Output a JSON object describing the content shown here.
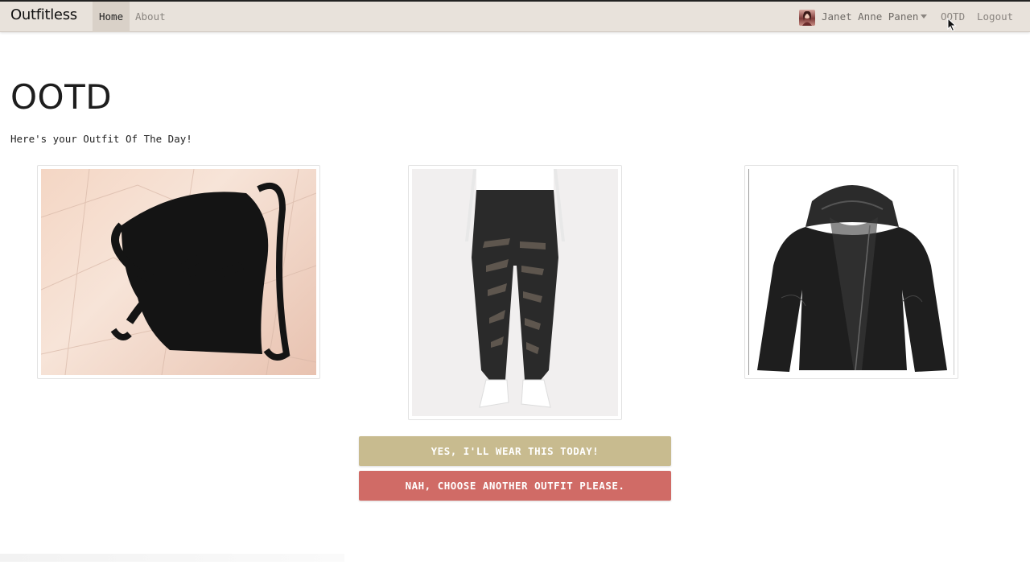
{
  "navbar": {
    "brand": "Outfitless",
    "links": {
      "home": "Home",
      "about": "About",
      "ootd": "OOTD",
      "logout": "Logout"
    },
    "user_name": "Janet Anne Panen",
    "background": "#e8e2db"
  },
  "page": {
    "title": "OOTD",
    "subtitle": "Here's your Outfit Of The Day!"
  },
  "outfit": {
    "items": [
      {
        "icon": "black-sports-bra-image"
      },
      {
        "icon": "black-mesh-leggings-image"
      },
      {
        "icon": "black-leather-hooded-jacket-image"
      }
    ]
  },
  "actions": {
    "accept_label": "Yes, I'll wear this today!",
    "reject_label": "Nah, choose another outfit please.",
    "accept_color": "#c8bb8f",
    "reject_color": "#d06b66"
  }
}
